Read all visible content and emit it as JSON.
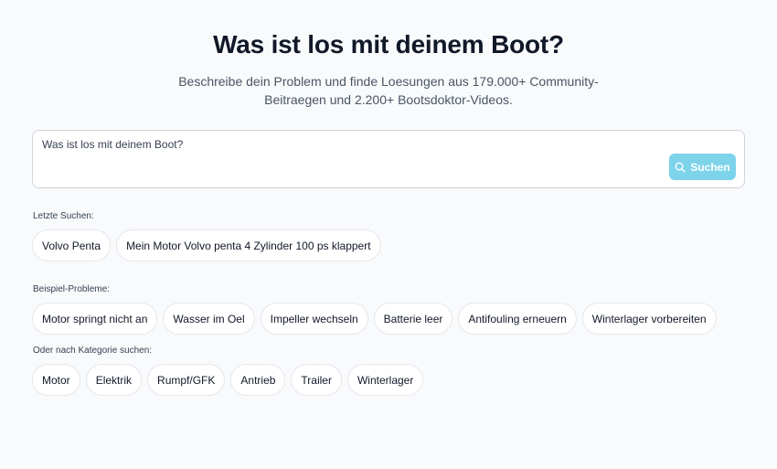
{
  "header": {
    "title": "Was ist los mit deinem Boot?",
    "subtitle": "Beschreibe dein Problem und finde Loesungen aus 179.000+ Community-Beitraegen und 2.200+ Bootsdoktor-Videos."
  },
  "search": {
    "placeholder": "Was ist los mit deinem Boot?",
    "value": "",
    "button_label": "Suchen",
    "button_color": "#7dd3ea",
    "button_icon": "search-icon"
  },
  "recent": {
    "label": "Letzte Suchen:",
    "items": [
      "Volvo Penta",
      "Mein Motor Volvo penta 4 Zylinder 100 ps klappert"
    ]
  },
  "examples": {
    "label": "Beispiel-Probleme:",
    "items": [
      "Motor springt nicht an",
      "Wasser im Oel",
      "Impeller wechseln",
      "Batterie leer",
      "Antifouling erneuern",
      "Winterlager vorbereiten"
    ]
  },
  "categories": {
    "label": "Oder nach Kategorie suchen:",
    "items": [
      "Motor",
      "Elektrik",
      "Rumpf/GFK",
      "Antrieb",
      "Trailer",
      "Winterlager"
    ]
  }
}
